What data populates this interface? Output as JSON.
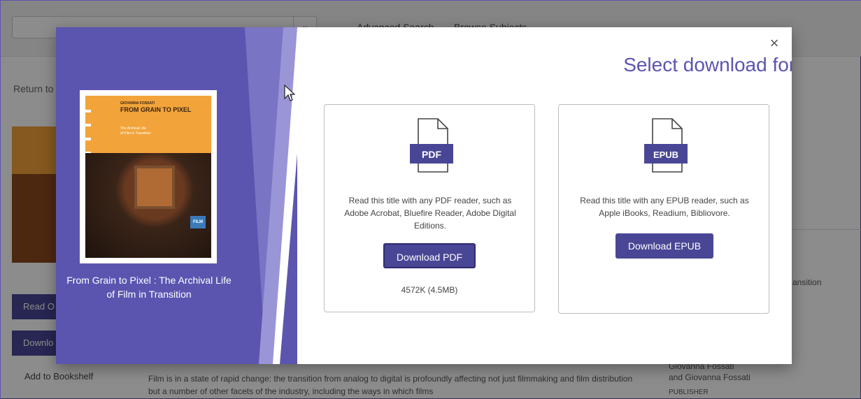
{
  "background": {
    "search_button": "»",
    "links": [
      "Advanced Search",
      "Browse Subjects"
    ],
    "return_text": "Return to",
    "read_online": "Read O",
    "download": "Downlo",
    "add_to_bookshelf": "Add to Bookshelf",
    "description": "Film is in a state of rapid change: the transition from analog to digital is profoundly affecting not just filmmaking and film distribution but a number of other facets of the industry, including the ways in which films",
    "right_snippet": "ansition",
    "author_line1": "Giovanna Fossati",
    "author_line2": "and Giovanna Fossati",
    "publisher_label": "PUBLISHER"
  },
  "modal": {
    "heading": "Select download format",
    "close_glyph": "×",
    "book_title": "From Grain to Pixel : The Archival Life of Film in Transition",
    "cover": {
      "author": "GIOVANNA FOSSATI",
      "title": "FROM GRAIN TO PIXEL",
      "subtitle_line1": "The Archival Life",
      "subtitle_line2": "of Film in Transition",
      "badge": "FILM"
    },
    "formats": [
      {
        "icon_label": "PDF",
        "description": "Read this title with any PDF reader, such as Adobe Acrobat, Bluefire Reader, Adobe Digital Editions.",
        "button": "Download PDF",
        "size": "4572K (4.5MB)"
      },
      {
        "icon_label": "EPUB",
        "description": "Read this title with any EPUB reader, such as Apple iBooks, Readium, Bibliovore.",
        "button": "Download EPUB"
      }
    ]
  },
  "colors": {
    "accent": "#5b55b0",
    "button": "#4a4696"
  }
}
